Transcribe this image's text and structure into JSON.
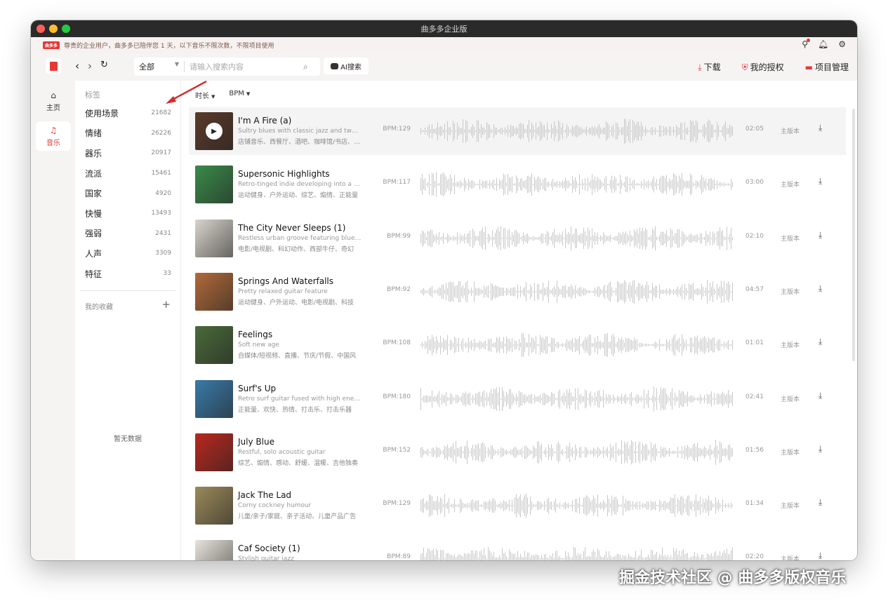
{
  "window": {
    "title": "曲多多企业版"
  },
  "notice": {
    "badge": "曲多多",
    "text": "尊贵的企业用户，曲多多已陪伴您 1 天，以下音乐不限次数，不限项目使用"
  },
  "toolbar": {
    "scope": "全部",
    "search_placeholder": "请输入搜索内容",
    "ai_label": "AI搜索",
    "download_label": "下载",
    "license_label": "我的授权",
    "project_label": "项目管理"
  },
  "rail": {
    "home": "主页",
    "music": "音乐"
  },
  "tags": {
    "header": "标签",
    "items": [
      {
        "name": "使用场景",
        "count": "21682"
      },
      {
        "name": "情绪",
        "count": "26226"
      },
      {
        "name": "器乐",
        "count": "20917"
      },
      {
        "name": "流派",
        "count": "15461"
      },
      {
        "name": "国家",
        "count": "4920"
      },
      {
        "name": "快慢",
        "count": "13493"
      },
      {
        "name": "强弱",
        "count": "2431"
      },
      {
        "name": "人声",
        "count": "3309"
      },
      {
        "name": "特征",
        "count": "33"
      }
    ],
    "favorites": "我的收藏",
    "empty": "暂无数据"
  },
  "filters": {
    "duration": "时长",
    "bpm": "BPM"
  },
  "tracks": [
    {
      "title": "I'm A Fire (a)",
      "desc": "Sultry blues with classic jazz and twang",
      "tags": "店铺音乐、西餐厅、酒吧、咖啡馆/书店、休闲",
      "bpm": "BPM:129",
      "duration": "02:05",
      "version": "主版本",
      "color": "#5a3a2a"
    },
    {
      "title": "Supersonic Highlights",
      "desc": "Retro-tinged indie developing into a pylon",
      "tags": "运动健身、户外运动、综艺、煽情、正能量",
      "bpm": "BPM:117",
      "duration": "03:00",
      "version": "主版本",
      "color": "#3a8a4a"
    },
    {
      "title": "The City Never Sleeps (1)",
      "desc": "Restless urban groove featuring bluesy guitar",
      "tags": "电影/电视剧、科幻动作、西部牛仔、奇幻",
      "bpm": "BPM:99",
      "duration": "02:10",
      "version": "主版本",
      "color": "#d8d4cc"
    },
    {
      "title": "Springs And Waterfalls",
      "desc": "Pretty relaxed guitar feature",
      "tags": "运动健身、户外运动、电影/电视剧、科技",
      "bpm": "BPM:92",
      "duration": "04:57",
      "version": "主版本",
      "color": "#b06a3a"
    },
    {
      "title": "Feelings",
      "desc": "Soft new age",
      "tags": "自媒体/短视频、直播、节庆/节假、中国风",
      "bpm": "BPM:108",
      "duration": "01:01",
      "version": "主版本",
      "color": "#4a6a3a"
    },
    {
      "title": "Surf's Up",
      "desc": "Retro surf guitar fused with high energy",
      "tags": "正能量、欢快、热情、打击乐、打击乐器",
      "bpm": "BPM:180",
      "duration": "02:41",
      "version": "主版本",
      "color": "#3a7aa8"
    },
    {
      "title": "July Blue",
      "desc": "Restful, solo acoustic guitar",
      "tags": "综艺、煽情、感动、舒缓、温暖、吉他独奏",
      "bpm": "BPM:152",
      "duration": "01:56",
      "version": "主版本",
      "color": "#b8281e"
    },
    {
      "title": "Jack The Lad",
      "desc": "Corny cockney humour",
      "tags": "儿童/亲子/家庭、亲子活动、儿童产品广告",
      "bpm": "BPM:129",
      "duration": "01:34",
      "version": "主版本",
      "color": "#9a8a5a"
    },
    {
      "title": "Caf Society (1)",
      "desc": "Stylish guitar jazz",
      "tags": "",
      "bpm": "BPM:89",
      "duration": "02:20",
      "version": "主版本",
      "color": "#e8e4dc"
    }
  ],
  "watermark": "掘金技术社区 @ 曲多多版权音乐",
  "colors": {
    "accent": "#e53935",
    "wave": "#c8c8c8"
  }
}
